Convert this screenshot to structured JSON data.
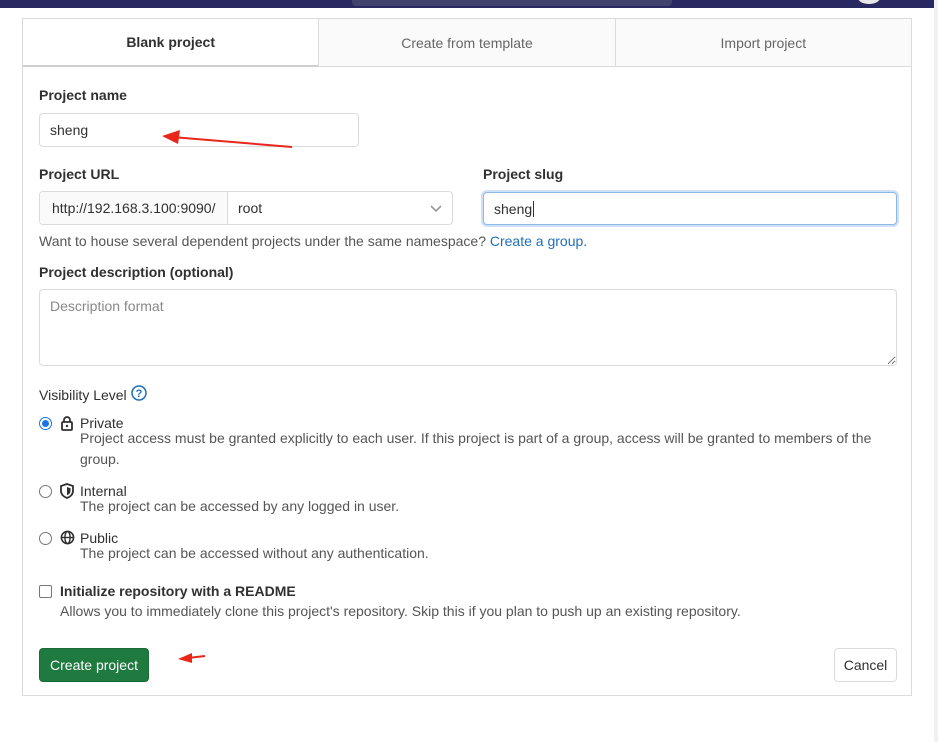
{
  "tabs": [
    {
      "label": "Blank project",
      "active": true
    },
    {
      "label": "Create from template",
      "active": false
    },
    {
      "label": "Import project",
      "active": false
    }
  ],
  "project_name": {
    "label": "Project name",
    "value": "sheng"
  },
  "project_url": {
    "label": "Project URL",
    "prefix": "http://192.168.3.100:9090/",
    "namespace": "root"
  },
  "project_slug": {
    "label": "Project slug",
    "value": "sheng"
  },
  "namespace_help": {
    "text": "Want to house several dependent projects under the same namespace?",
    "link": "Create a group."
  },
  "description": {
    "label": "Project description (optional)",
    "placeholder": "Description format"
  },
  "visibility": {
    "label": "Visibility Level",
    "options": [
      {
        "title": "Private",
        "desc": "Project access must be granted explicitly to each user. If this project is part of a group, access will be granted to members of the group.",
        "checked": true,
        "icon": "lock-icon"
      },
      {
        "title": "Internal",
        "desc": "The project can be accessed by any logged in user.",
        "checked": false,
        "icon": "shield-icon"
      },
      {
        "title": "Public",
        "desc": "The project can be accessed without any authentication.",
        "checked": false,
        "icon": "globe-icon"
      }
    ]
  },
  "readme": {
    "label": "Initialize repository with a README",
    "desc": "Allows you to immediately clone this project's repository. Skip this if you plan to push up an existing repository.",
    "checked": false
  },
  "actions": {
    "create": "Create project",
    "cancel": "Cancel"
  },
  "colors": {
    "accent": "#1f7a3f",
    "link": "#1f6fb6",
    "annotation_arrow": "#e8261c",
    "radio": "#1a73e8"
  }
}
